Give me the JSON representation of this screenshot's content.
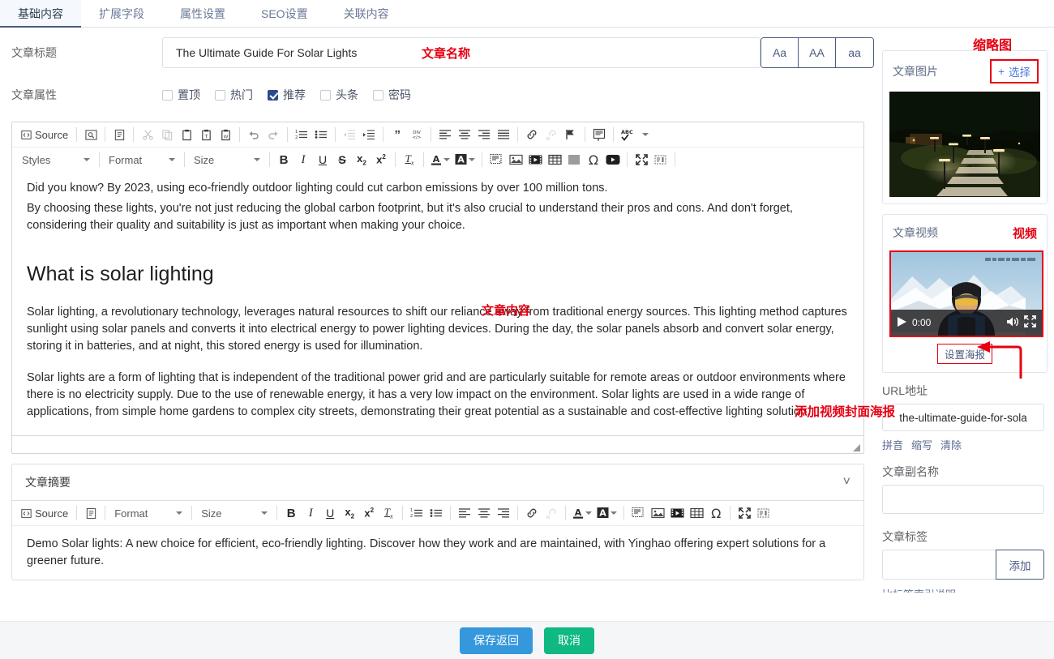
{
  "tabs": [
    {
      "label": "基础内容",
      "active": true
    },
    {
      "label": "扩展字段",
      "active": false
    },
    {
      "label": "属性设置",
      "active": false
    },
    {
      "label": "SEO设置",
      "active": false
    },
    {
      "label": "关联内容",
      "active": false
    }
  ],
  "form": {
    "title_label": "文章标题",
    "title_value": "The Ultimate Guide For Solar Lights",
    "title_placeholder": "请输入文章标题",
    "case_buttons": [
      "Aa",
      "AA",
      "aa"
    ],
    "attr_label": "文章属性",
    "attributes": [
      {
        "label": "置顶",
        "checked": false
      },
      {
        "label": "热门",
        "checked": false
      },
      {
        "label": "推荐",
        "checked": true
      },
      {
        "label": "头条",
        "checked": false
      },
      {
        "label": "密码",
        "checked": false
      }
    ]
  },
  "annotations": {
    "title_name": "文章名称",
    "content": "文章内容",
    "thumbnail": "缩略图",
    "video": "视频",
    "add_poster": "添加视频封面海报",
    "summary": "文章摘要"
  },
  "editor": {
    "toolbar_row1": [
      {
        "name": "source-button",
        "glyph": "◧",
        "label": "Source",
        "type": "text-button"
      },
      {
        "name": "separator",
        "type": "sep"
      },
      {
        "name": "preview-icon",
        "glyph": "🔍",
        "type": "icon"
      },
      {
        "name": "separator",
        "type": "sep"
      },
      {
        "name": "templates-icon",
        "glyph": "🗎",
        "type": "icon"
      },
      {
        "name": "separator",
        "type": "sep"
      },
      {
        "name": "cut-icon",
        "glyph": "✂",
        "type": "icon",
        "disabled": true
      },
      {
        "name": "copy-icon",
        "glyph": "⧉",
        "type": "icon",
        "disabled": true
      },
      {
        "name": "paste-icon",
        "glyph": "📋",
        "type": "icon"
      },
      {
        "name": "paste-as-text-icon",
        "glyph": "📋",
        "type": "icon"
      },
      {
        "name": "paste-from-word-icon",
        "glyph": "📋",
        "type": "icon"
      },
      {
        "name": "separator",
        "type": "sep"
      },
      {
        "name": "undo-icon",
        "glyph": "↰",
        "type": "icon"
      },
      {
        "name": "redo-icon",
        "glyph": "↱",
        "type": "icon"
      },
      {
        "name": "separator",
        "type": "sep"
      },
      {
        "name": "numbered-list-icon",
        "glyph": "≔",
        "type": "icon"
      },
      {
        "name": "bulleted-list-icon",
        "glyph": "≡",
        "type": "icon"
      },
      {
        "name": "separator",
        "type": "sep"
      },
      {
        "name": "decrease-indent-icon",
        "glyph": "⇤",
        "type": "icon",
        "disabled": true
      },
      {
        "name": "increase-indent-icon",
        "glyph": "⇥",
        "type": "icon"
      },
      {
        "name": "separator",
        "type": "sep"
      },
      {
        "name": "blockquote-icon",
        "glyph": "❞",
        "type": "icon"
      },
      {
        "name": "create-div-icon",
        "glyph": "◱",
        "type": "icon"
      },
      {
        "name": "separator",
        "type": "sep"
      },
      {
        "name": "align-left-icon",
        "glyph": "≡",
        "type": "icon"
      },
      {
        "name": "align-center-icon",
        "glyph": "≡",
        "type": "icon"
      },
      {
        "name": "align-right-icon",
        "glyph": "≡",
        "type": "icon"
      },
      {
        "name": "justify-icon",
        "glyph": "≡",
        "type": "icon"
      },
      {
        "name": "separator",
        "type": "sep"
      },
      {
        "name": "link-icon",
        "glyph": "🔗",
        "type": "icon"
      },
      {
        "name": "unlink-icon",
        "glyph": "🔗",
        "type": "icon",
        "disabled": true
      },
      {
        "name": "anchor-icon",
        "glyph": "⚑",
        "type": "icon"
      },
      {
        "name": "separator",
        "type": "sep"
      },
      {
        "name": "text-template-icon",
        "glyph": "▤",
        "type": "icon"
      },
      {
        "name": "separator",
        "type": "sep"
      },
      {
        "name": "spellcheck-icon",
        "glyph": "ABC",
        "type": "icon-caret"
      }
    ],
    "dropdowns": [
      {
        "name": "styles-dropdown",
        "label": "Styles"
      },
      {
        "name": "format-dropdown",
        "label": "Format"
      },
      {
        "name": "size-dropdown",
        "label": "Size"
      }
    ],
    "toolbar_row2": [
      {
        "name": "bold-icon",
        "glyph": "B",
        "type": "bold"
      },
      {
        "name": "italic-icon",
        "glyph": "I",
        "type": "italic"
      },
      {
        "name": "underline-icon",
        "glyph": "U",
        "type": "underline"
      },
      {
        "name": "strikethrough-icon",
        "glyph": "S",
        "type": "strike"
      },
      {
        "name": "subscript-icon",
        "glyph": "x₂",
        "type": "icon"
      },
      {
        "name": "superscript-icon",
        "glyph": "x²",
        "type": "icon"
      },
      {
        "name": "separator",
        "type": "sep"
      },
      {
        "name": "remove-format-icon",
        "glyph": "Tx",
        "type": "icon"
      },
      {
        "name": "separator",
        "type": "sep"
      },
      {
        "name": "text-color-icon",
        "glyph": "A",
        "type": "icon-caret"
      },
      {
        "name": "background-color-icon",
        "glyph": "A",
        "type": "icon-caret-inv"
      },
      {
        "name": "separator",
        "type": "sep"
      },
      {
        "name": "code-snippet-icon",
        "glyph": "▥",
        "type": "icon"
      },
      {
        "name": "image-icon",
        "glyph": "🖼",
        "type": "icon"
      },
      {
        "name": "media-icon",
        "glyph": "🎞",
        "type": "icon"
      },
      {
        "name": "table-icon",
        "glyph": "▦",
        "type": "icon"
      },
      {
        "name": "horizontal-rule-icon",
        "glyph": "▤",
        "type": "icon"
      },
      {
        "name": "special-char-icon",
        "glyph": "Ω",
        "type": "icon"
      },
      {
        "name": "youtube-icon",
        "glyph": "▶",
        "type": "icon"
      },
      {
        "name": "separator",
        "type": "sep"
      },
      {
        "name": "maximize-icon",
        "glyph": "⤢",
        "type": "icon"
      },
      {
        "name": "show-blocks-icon",
        "glyph": "▯",
        "type": "icon"
      }
    ],
    "content": {
      "para1": "Did you know? By 2023, using eco-friendly outdoor lighting could cut carbon emissions by over 100 million tons.",
      "para2": "By choosing these lights, you're not just reducing the global carbon footprint, but it's also crucial to understand their pros and cons. And don't forget, considering their quality and suitability is just as important when making your choice.",
      "heading": "What is solar lighting",
      "para3": "Solar lighting, a revolutionary technology, leverages natural resources to shift our reliance away from traditional energy sources. This lighting method captures sunlight using solar panels and converts it into electrical energy to power lighting devices. During the day, the solar panels absorb and convert solar energy, storing it in batteries, and at night, this stored energy is used for illumination.",
      "para4": "Solar lights are a form of lighting that is independent of the traditional power grid and are particularly suitable for remote areas or outdoor environments where there is no electricity supply. Due to the use of renewable energy, it has a very low impact on the environment. Solar lights are used in a wide range of applications, from simple home gardens to complex city streets, demonstrating their great potential as a sustainable and cost-effective lighting solution."
    }
  },
  "summary": {
    "header_label": "文章摘要",
    "toolbar": [
      {
        "name": "source-button",
        "label": "Source"
      },
      {
        "name": "templates-icon",
        "glyph": "🗎"
      },
      {
        "name": "format-dropdown",
        "label": "Format"
      },
      {
        "name": "size-dropdown",
        "label": "Size"
      },
      {
        "name": "bold-icon",
        "glyph": "B"
      },
      {
        "name": "italic-icon",
        "glyph": "I"
      },
      {
        "name": "underline-icon",
        "glyph": "U"
      },
      {
        "name": "subscript-icon",
        "glyph": "x₂"
      },
      {
        "name": "superscript-icon",
        "glyph": "x²"
      },
      {
        "name": "remove-format-icon",
        "glyph": "Tx"
      },
      {
        "name": "numbered-list-icon",
        "glyph": "≔"
      },
      {
        "name": "bulleted-list-icon",
        "glyph": "≡"
      },
      {
        "name": "align-left-icon",
        "glyph": "≡"
      },
      {
        "name": "align-center-icon",
        "glyph": "≡"
      },
      {
        "name": "align-right-icon",
        "glyph": "≡"
      },
      {
        "name": "link-icon",
        "glyph": "🔗"
      },
      {
        "name": "unlink-icon",
        "glyph": "🔗"
      },
      {
        "name": "text-color-icon",
        "glyph": "A"
      },
      {
        "name": "background-color-icon",
        "glyph": "A"
      },
      {
        "name": "code-snippet-icon",
        "glyph": "▥"
      },
      {
        "name": "image-icon",
        "glyph": "🖼"
      },
      {
        "name": "media-icon",
        "glyph": "🎞"
      },
      {
        "name": "table-icon",
        "glyph": "▦"
      },
      {
        "name": "special-char-icon",
        "glyph": "Ω"
      },
      {
        "name": "maximize-icon",
        "glyph": "⤢"
      },
      {
        "name": "show-blocks-icon",
        "glyph": "▯"
      }
    ],
    "text": "Demo Solar lights: A new choice for efficient, eco-friendly lighting. Discover how they work and are maintained, with Yinghao offering expert solutions for a greener future."
  },
  "footer": {
    "save_label": "保存返回",
    "cancel_label": "取消",
    "save_color": "#3598dc",
    "cancel_color": "#10b981"
  },
  "sidebar": {
    "image_panel": {
      "title": "文章图片",
      "select_label": "选择",
      "select_plus": "+"
    },
    "video_panel": {
      "title": "文章视频",
      "time": "0:00",
      "poster_label": "设置海报"
    },
    "url_field": {
      "label": "URL地址",
      "value": "the-ultimate-guide-for-sola",
      "links": [
        "拼音",
        "缩写",
        "清除"
      ]
    },
    "subtitle_field": {
      "label": "文章副名称",
      "value": "",
      "placeholder": ""
    },
    "tag_field": {
      "label": "文章标签",
      "value": "",
      "placeholder": "",
      "add_label": "添加"
    },
    "cut_off_label": "比标签索引说明"
  }
}
